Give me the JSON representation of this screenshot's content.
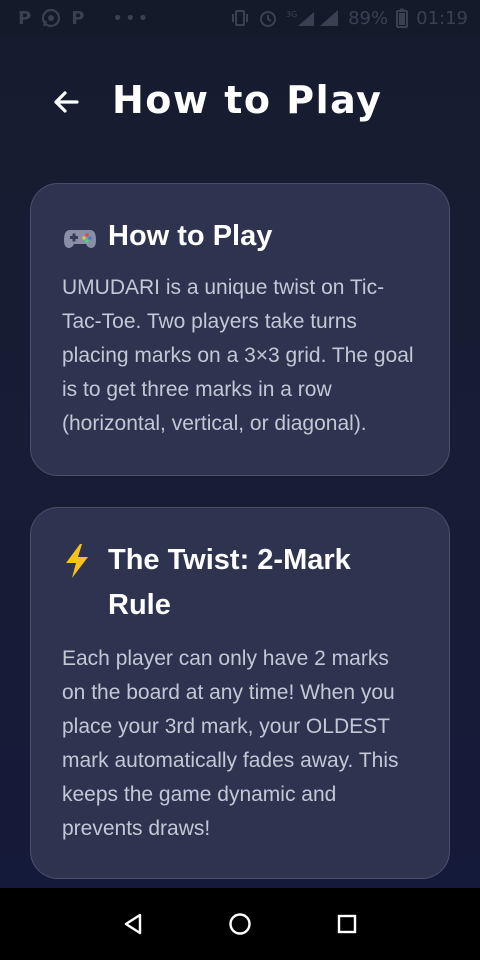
{
  "status_bar": {
    "left_glyphs": [
      "P",
      "P"
    ],
    "dots": "•••",
    "network_label": "3G",
    "battery": "89%",
    "time": "01:19",
    "icons": [
      "p-icon",
      "whatsapp-icon",
      "p-icon",
      "vibrate-icon",
      "alarm-icon",
      "signal-icon",
      "battery-icon"
    ]
  },
  "header": {
    "title": "How to Play",
    "back_icon": "arrow-left-icon"
  },
  "cards": [
    {
      "emoji": "gamepad-icon",
      "title": "How to Play",
      "body": "UMUDARI is a unique twist on Tic-Tac-Toe. Two players take turns placing marks on a 3×3 grid. The goal is to get three marks in a row (horizontal, vertical, or diagonal)."
    },
    {
      "emoji": "lightning-icon",
      "title": "The Twist: 2-Mark Rule",
      "body": "Each player can only have 2 marks on the board at any time! When you place your 3rd mark, your OLDEST mark automatically fades away. This keeps the game dynamic and prevents draws!"
    }
  ],
  "nav_bar": {
    "buttons": [
      "back-triangle-icon",
      "home-circle-icon",
      "recents-square-icon"
    ]
  },
  "colors": {
    "background": "#171b2f",
    "card": "#2e3350",
    "card_border": "#4a4f6d",
    "title": "#ffffff",
    "body_text": "#c4c7d4",
    "lightning": "#f7c21c"
  }
}
